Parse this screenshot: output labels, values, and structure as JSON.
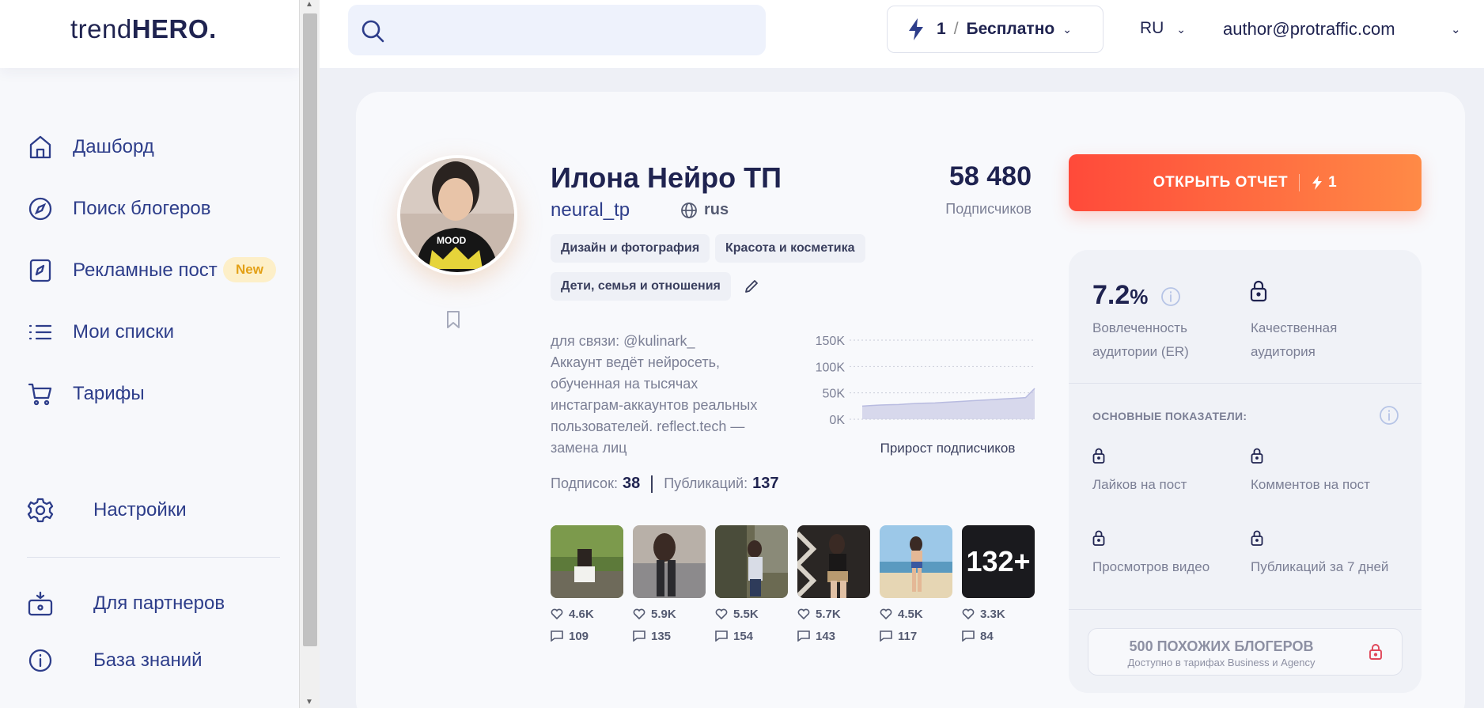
{
  "logo": {
    "light": "trend",
    "bold": "HERO",
    "dot": "."
  },
  "sidebar": {
    "items": [
      {
        "label": "Дашборд",
        "icon": "home-icon"
      },
      {
        "label": "Поиск блогеров",
        "icon": "compass-icon"
      },
      {
        "label": "Рекламные пост",
        "icon": "ad-post-icon",
        "badge": "New"
      },
      {
        "label": "Мои списки",
        "icon": "list-icon"
      },
      {
        "label": "Тарифы",
        "icon": "cart-icon"
      }
    ],
    "settings": {
      "label": "Настройки",
      "icon": "gear-icon"
    },
    "bottom": [
      {
        "label": "Для партнеров",
        "icon": "partners-icon"
      },
      {
        "label": "База знаний",
        "icon": "info-icon"
      }
    ]
  },
  "topbar": {
    "search": {
      "placeholder": ""
    },
    "plan": {
      "count": "1",
      "separator": "/",
      "name": "Бесплатно"
    },
    "language": "RU",
    "user_email": "author@protraffic.com"
  },
  "profile": {
    "name": "Илона Нейро ТП",
    "handle": "neural_tp",
    "language": "rus",
    "followers": "58 480",
    "followers_label": "Подписчиков",
    "tags": [
      "Дизайн и фотография",
      "Красота и косметика",
      "Дети, семья и отношения"
    ],
    "bio": "для связи: @kulinark_\nАккаунт ведёт нейросеть, обученная на тысячах инстаграм-аккаунтов реальных пользователей. reflect.tech — замена лиц",
    "following_label": "Подписок:",
    "following": "38",
    "posts_label": "Публикаций:",
    "posts_count": "137",
    "more_posts": "132+",
    "posts": [
      {
        "likes": "4.6K",
        "comments": "109"
      },
      {
        "likes": "5.9K",
        "comments": "135"
      },
      {
        "likes": "5.5K",
        "comments": "154"
      },
      {
        "likes": "5.7K",
        "comments": "143"
      },
      {
        "likes": "4.5K",
        "comments": "117"
      },
      {
        "likes": "3.3K",
        "comments": "84"
      }
    ]
  },
  "chart_data": {
    "type": "area",
    "title": "Прирост подписчиков",
    "yticks": [
      "150K",
      "100K",
      "50K",
      "0K"
    ],
    "ylim": [
      0,
      150000
    ],
    "values": [
      25000,
      26000,
      27000,
      27500,
      28000,
      29000,
      30000,
      30500,
      31000,
      32000,
      33000,
      34000,
      35000,
      36000,
      37000,
      38000,
      39000,
      40000,
      41000,
      58480
    ],
    "color": "#c9cbe6",
    "grid": true
  },
  "report": {
    "open_label": "ОТКРЫТЬ ОТЧЕТ",
    "credits": "1",
    "er_value": "7.2",
    "er_unit": "%",
    "er_label": "Вовлеченность аудитории (ER)",
    "quality_label": "Качественная аудитория",
    "section_title": "ОСНОВНЫЕ ПОКАЗАТЕЛИ:",
    "metrics": [
      "Лайков на пост",
      "Комментов на пост",
      "Просмотров видео",
      "Публикаций за 7 дней"
    ],
    "similar_title": "500 ПОХОЖИХ БЛОГЕРОВ",
    "similar_sub": "Доступно в тарифах Business и Agency"
  },
  "colors": {
    "accent": "#2d3d8a",
    "brand_orange": "#ff6a3d",
    "badge_bg": "#fdefc8",
    "badge_text": "#e3a016",
    "lock_red": "#e0485a"
  }
}
